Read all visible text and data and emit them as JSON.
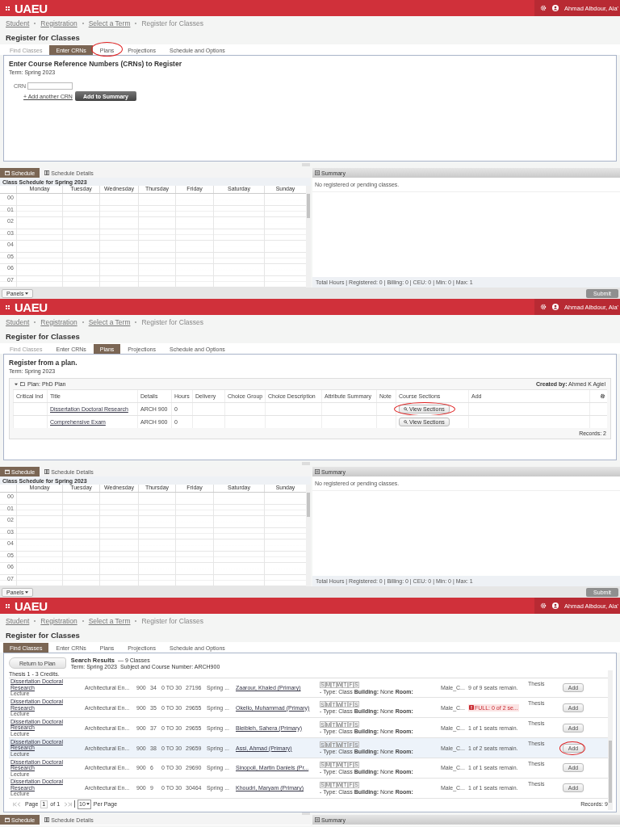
{
  "screens": [
    {
      "kind": "crn",
      "header": {
        "logo": "UAEU",
        "user": "Ahmad Albdour, Ala'"
      },
      "breadcrumbs": [
        {
          "label": "Student",
          "link": true
        },
        {
          "label": "Registration",
          "link": true
        },
        {
          "label": "Select a Term",
          "link": true
        },
        {
          "label": "Register for Classes",
          "link": false
        }
      ],
      "page_title": "Register for Classes",
      "tabs": [
        {
          "label": "Find Classes",
          "selected": false,
          "disabled": true,
          "circled": false
        },
        {
          "label": "Enter CRNs",
          "selected": true,
          "disabled": false,
          "circled": false
        },
        {
          "label": "Plans",
          "selected": false,
          "disabled": false,
          "circled": true
        },
        {
          "label": "Projections",
          "selected": false,
          "disabled": false,
          "circled": false
        },
        {
          "label": "Schedule and Options",
          "selected": false,
          "disabled": false,
          "circled": false
        }
      ],
      "crn": {
        "heading": "Enter Course Reference Numbers (CRNs) to Register",
        "term": "Term: Spring 2023",
        "field_label": "CRN",
        "add_link": "+ Add another CRN",
        "button": "Add to Summary"
      },
      "bottom": {
        "schedule_tabs": [
          {
            "label": "Schedule",
            "selected": true
          },
          {
            "label": "Schedule Details",
            "selected": false
          }
        ],
        "schedule_title": "Class Schedule for Spring 2023",
        "days": [
          "Monday",
          "Tuesday",
          "Wednesday",
          "Thursday",
          "Friday",
          "Saturday",
          "Sunday"
        ],
        "hours": [
          "00",
          "01",
          "02",
          "03",
          "04",
          "05",
          "06",
          "07"
        ],
        "summary_title": "Summary",
        "summary_message": "No registered or pending classes.",
        "summary_totals": "Total Hours | Registered: 0 | Billing: 0 | CEU: 0 | Min: 0 | Max: 1"
      },
      "footer": {
        "panels": "Panels",
        "submit": "Submit"
      }
    },
    {
      "kind": "plan",
      "header": {
        "logo": "UAEU",
        "user": "Ahmad Albdour, Ala'"
      },
      "breadcrumbs": [
        {
          "label": "Student",
          "link": true
        },
        {
          "label": "Registration",
          "link": true
        },
        {
          "label": "Select a Term",
          "link": true
        },
        {
          "label": "Register for Classes",
          "link": false
        }
      ],
      "page_title": "Register for Classes",
      "tabs": [
        {
          "label": "Find Classes",
          "selected": false,
          "disabled": true,
          "circled": false
        },
        {
          "label": "Enter CRNs",
          "selected": false,
          "disabled": false,
          "circled": false
        },
        {
          "label": "Plans",
          "selected": true,
          "disabled": false,
          "circled": false
        },
        {
          "label": "Projections",
          "selected": false,
          "disabled": false,
          "circled": false
        },
        {
          "label": "Schedule and Options",
          "selected": false,
          "disabled": false,
          "circled": false
        }
      ],
      "plan": {
        "heading": "Register from a plan.",
        "term": "Term: Spring 2023",
        "plan_name": "Plan: PhD Plan",
        "created_by": "**Created by:** Ahmed K Agiel",
        "columns": [
          "Critical Ind",
          "Title",
          "Details",
          "Hours",
          "Delivery",
          "Choice Group",
          "Choice Description",
          "Attribute Summary",
          "Note",
          "Course Sections",
          "Add"
        ],
        "rows": [
          {
            "title": "Dissertation Doctoral Research",
            "details": "ARCH 900",
            "hours": "0",
            "button": "View Sections",
            "circled": true
          },
          {
            "title": "Comprehensive Exam",
            "details": "ARCH 900",
            "hours": "0",
            "button": "View Sections",
            "circled": false
          }
        ],
        "records": "Records: 2"
      },
      "bottom": {
        "schedule_tabs": [
          {
            "label": "Schedule",
            "selected": true
          },
          {
            "label": "Schedule Details",
            "selected": false
          }
        ],
        "schedule_title": "Class Schedule for Spring 2023",
        "days": [
          "Monday",
          "Tuesday",
          "Wednesday",
          "Thursday",
          "Friday",
          "Saturday",
          "Sunday"
        ],
        "hours": [
          "00",
          "01",
          "02",
          "03",
          "04",
          "05",
          "06",
          "07"
        ],
        "summary_title": "Summary",
        "summary_message": "No registered or pending classes.",
        "summary_totals": "Total Hours | Registered: 0 | Billing: 0 | CEU: 0 | Min: 0 | Max: 1"
      },
      "footer": {
        "panels": "Panels",
        "submit": "Submit"
      }
    },
    {
      "kind": "search",
      "header": {
        "logo": "UAEU",
        "user": "Ahmad Albdour, Ala'"
      },
      "breadcrumbs": [
        {
          "label": "Student",
          "link": true
        },
        {
          "label": "Registration",
          "link": true
        },
        {
          "label": "Select a Term",
          "link": true
        },
        {
          "label": "Register for Classes",
          "link": false
        }
      ],
      "page_title": "Register for Classes",
      "tabs": [
        {
          "label": "Find Classes",
          "selected": true,
          "disabled": false,
          "circled": false
        },
        {
          "label": "Enter CRNs",
          "selected": false,
          "disabled": false,
          "circled": false
        },
        {
          "label": "Plans",
          "selected": false,
          "disabled": false,
          "circled": false
        },
        {
          "label": "Projections",
          "selected": false,
          "disabled": false,
          "circled": false
        },
        {
          "label": "Schedule and Options",
          "selected": false,
          "disabled": false,
          "circled": false
        }
      ],
      "search": {
        "return_button": "Return to Plan",
        "heading": "Search Results",
        "count": "— 9 Classes",
        "term": "Term: Spring 2023",
        "subject": "Subject and Course Number: ARCH900",
        "note": "Thesis 1 - 3 Credits.",
        "rows": [
          {
            "title": "Dissertation Doctoral Research",
            "type": "Lecture",
            "subject": "Architectural En...",
            "course": "900",
            "section": "34",
            "hours": "0 TO 30",
            "crn": "27196",
            "term": "Spring ...",
            "instructor": "Zaarour, Khaled (Primary)",
            "days": [
              "S",
              "M",
              "T",
              "W",
              "T",
              "F",
              "S"
            ],
            "meeting": "- Type: Class **Building:** None **Room:**",
            "campus": "Male_C...",
            "status": "9 of 9 seats remain.",
            "full": false,
            "attribute": "Thesis",
            "add": "Add",
            "selected": false,
            "circled": false
          },
          {
            "title": "Dissertation Doctoral Research",
            "type": "Lecture",
            "subject": "Architectural En...",
            "course": "900",
            "section": "35",
            "hours": "0 TO 30",
            "crn": "29655",
            "term": "Spring ...",
            "instructor": "Okello, Muhammad (Primary)",
            "days": [
              "S",
              "M",
              "T",
              "W",
              "T",
              "F",
              "S"
            ],
            "meeting": "- Type: Class **Building:** None **Room:**",
            "campus": "Male_C...",
            "status": "FULL: 0 of 2 se...",
            "full": true,
            "attribute": "Thesis",
            "add": "Add",
            "selected": false,
            "circled": false
          },
          {
            "title": "Dissertation Doctoral Research",
            "type": "Lecture",
            "subject": "Architectural En...",
            "course": "900",
            "section": "37",
            "hours": "0 TO 30",
            "crn": "29655",
            "term": "Spring ...",
            "instructor": "Bleibleh, Sahera (Primary)",
            "days": [
              "S",
              "M",
              "T",
              "W",
              "T",
              "F",
              "S"
            ],
            "meeting": "- Type: Class **Building:** None **Room:**",
            "campus": "Male_C...",
            "status": "1 of 1 seats remain.",
            "full": false,
            "attribute": "Thesis",
            "add": "Add",
            "selected": false,
            "circled": false
          },
          {
            "title": "Dissertation Doctoral Research",
            "type": "Lecture",
            "subject": "Architectural En...",
            "course": "900",
            "section": "38",
            "hours": "0 TO 30",
            "crn": "29659",
            "term": "Spring ...",
            "instructor": "Assi, Ahmad (Primary)",
            "days": [
              "S",
              "M",
              "T",
              "W",
              "T",
              "F",
              "S"
            ],
            "meeting": "- Type: Class **Building:** None **Room:**",
            "campus": "Male_C...",
            "status": "1 of 2 seats remain.",
            "full": false,
            "attribute": "Thesis",
            "add": "Add",
            "selected": true,
            "circled": true
          },
          {
            "title": "Dissertation Doctoral Research",
            "type": "Lecture",
            "subject": "Architectural En...",
            "course": "900",
            "section": "6",
            "hours": "0 TO 30",
            "crn": "29690",
            "term": "Spring ...",
            "instructor": "Sinopoli, Martin Daniels (Pr...",
            "days": [
              "S",
              "M",
              "T",
              "W",
              "T",
              "F",
              "S"
            ],
            "meeting": "- Type: Class **Building:** None **Room:**",
            "campus": "Male_C...",
            "status": "1 of 1 seats remain.",
            "full": false,
            "attribute": "Thesis",
            "add": "Add",
            "selected": false,
            "circled": false
          },
          {
            "title": "Dissertation Doctoral Research",
            "type": "Lecture",
            "subject": "Architectural En...",
            "course": "900",
            "section": "9",
            "hours": "0 TO 30",
            "crn": "30464",
            "term": "Spring ...",
            "instructor": "Khoudri, Maryam (Primary)",
            "days": [
              "S",
              "M",
              "T",
              "W",
              "T",
              "F",
              "S"
            ],
            "meeting": "- Type: Class **Building:** None **Room:**",
            "campus": "Male_C...",
            "status": "1 of 1 seats remain.",
            "full": false,
            "attribute": "Thesis",
            "add": "Add",
            "selected": false,
            "circled": false
          }
        ],
        "pager": {
          "page": "Page",
          "current": "1",
          "of": "of 1",
          "per_page_value": "10",
          "per_page": "Per Page"
        },
        "records": "Records: 9"
      },
      "bottom": {
        "schedule_tabs": [
          {
            "label": "Schedule",
            "selected": true
          },
          {
            "label": "Schedule Details",
            "selected": false
          }
        ],
        "summary_title": "Summary"
      }
    }
  ]
}
